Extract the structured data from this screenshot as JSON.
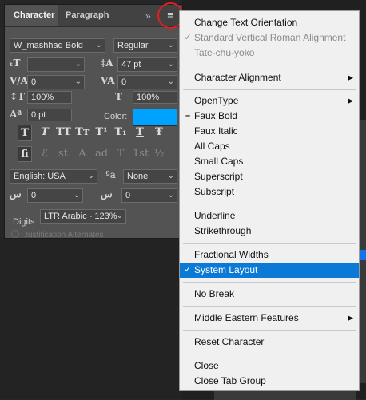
{
  "panel": {
    "tabs": [
      "Character",
      "Paragraph"
    ],
    "collapse_glyph": "»",
    "menu_glyph": "≡",
    "font_family": "W_mashhad Bold",
    "font_style": "Regular",
    "font_size": "",
    "leading": "47 pt",
    "kerning": "0",
    "tracking": "0",
    "vertical_scale": "100%",
    "horizontal_scale": "100%",
    "baseline_shift": "0 pt",
    "color_label": "Color:",
    "color": "#00a2ff",
    "type_buttons": [
      "T",
      "T",
      "TT",
      "Tт",
      "T¹",
      "T₁",
      "T",
      "Ŧ"
    ],
    "opentype_buttons": [
      "fi",
      "ℰ",
      "st",
      "A",
      "ad",
      "T",
      "1st",
      "½"
    ],
    "language": "English: USA",
    "antialias_icon": "ªa",
    "antialias": "None",
    "diacritic_1": "0",
    "diacritic_2": "0",
    "digits_label": "Digits",
    "digits_value": "LTR Arabic - 123%",
    "justification_alternates": "Justification Alternates"
  },
  "menu": {
    "items": [
      {
        "label": "Change Text Orientation"
      },
      {
        "label": "Standard Vertical Roman Alignment",
        "disabled": true,
        "mark": "check"
      },
      {
        "label": "Tate-chu-yoko",
        "disabled": true
      },
      {
        "label": "Character Alignment",
        "submenu": true
      },
      {
        "label": "OpenType",
        "submenu": true
      },
      {
        "label": "Faux Bold",
        "mark": "dash"
      },
      {
        "label": "Faux Italic"
      },
      {
        "label": "All Caps"
      },
      {
        "label": "Small Caps"
      },
      {
        "label": "Superscript"
      },
      {
        "label": "Subscript"
      },
      {
        "label": "Underline"
      },
      {
        "label": "Strikethrough"
      },
      {
        "label": "Fractional Widths"
      },
      {
        "label": "System Layout",
        "mark": "check",
        "highlighted": true
      },
      {
        "label": "No Break"
      },
      {
        "label": "Middle Eastern Features",
        "submenu": true
      },
      {
        "label": "Reset Character"
      },
      {
        "label": "Close"
      },
      {
        "label": "Close Tab Group"
      }
    ]
  },
  "colors": {
    "accent": "#0b7ad6",
    "highlight_circle": "#e02020"
  }
}
